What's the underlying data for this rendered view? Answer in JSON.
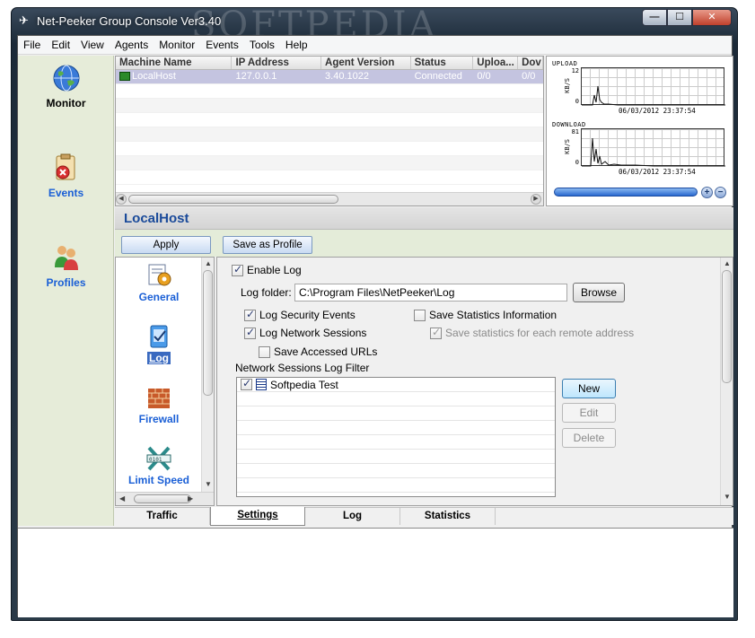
{
  "window": {
    "title": "Net-Peeker Group Console Ver3.40",
    "controls": {
      "minimize": "—",
      "maximize": "☐",
      "close": "✕"
    }
  },
  "menu": [
    "File",
    "Edit",
    "View",
    "Agents",
    "Monitor",
    "Events",
    "Tools",
    "Help"
  ],
  "nav": {
    "monitor": "Monitor",
    "events": "Events",
    "profiles": "Profiles"
  },
  "machines": {
    "columns": [
      "Machine Name",
      "IP Address",
      "Agent Version",
      "Status",
      "Uploa...",
      "Dov"
    ],
    "rows": [
      {
        "name": "LocalHost",
        "ip": "127.0.0.1",
        "version": "3.40.1022",
        "status": "Connected",
        "upload": "0/0",
        "down": "0/0"
      }
    ]
  },
  "graphs": {
    "upload": {
      "title": "UPLOAD",
      "max": "12",
      "min": "0",
      "unit": "KB/S",
      "time": "06/03/2012 23:37:54"
    },
    "download": {
      "title": "DOWNLOAD",
      "max": "81",
      "min": "0",
      "unit": "KB/S",
      "time": "06/03/2012 23:37:54"
    },
    "zoom_in": "+",
    "zoom_out": "−"
  },
  "host": {
    "title": "LocalHost"
  },
  "actions": {
    "apply": "Apply",
    "save_profile": "Save as Profile"
  },
  "categories": {
    "general": "General",
    "log": "Log",
    "firewall": "Firewall",
    "limit_speed": "Limit Speed"
  },
  "log_settings": {
    "enable_log": {
      "label": "Enable Log",
      "checked": true
    },
    "folder_label": "Log folder:",
    "folder_value": "C:\\Program Files\\NetPeeker\\Log",
    "browse": "Browse",
    "log_security": {
      "label": "Log Security Events",
      "checked": true
    },
    "log_network": {
      "label": "Log Network Sessions",
      "checked": true
    },
    "save_urls": {
      "label": "Save Accessed URLs",
      "checked": false
    },
    "save_stats": {
      "label": "Save Statistics Information",
      "checked": false
    },
    "save_stats_remote": {
      "label": "Save statistics for each remote address",
      "checked": true
    },
    "filter_group": "Network Sessions Log Filter",
    "filters": [
      {
        "name": "Softpedia Test",
        "checked": true
      }
    ],
    "new": "New",
    "edit": "Edit",
    "delete": "Delete"
  },
  "tabs": [
    "Traffic",
    "Settings",
    "Log",
    "Statistics"
  ],
  "watermark": "SOFTPEDIA",
  "colors": {
    "accent": "#1a5fd6",
    "nav_bg": "#e6ecd9",
    "selected_row": "#c4c4e0"
  }
}
